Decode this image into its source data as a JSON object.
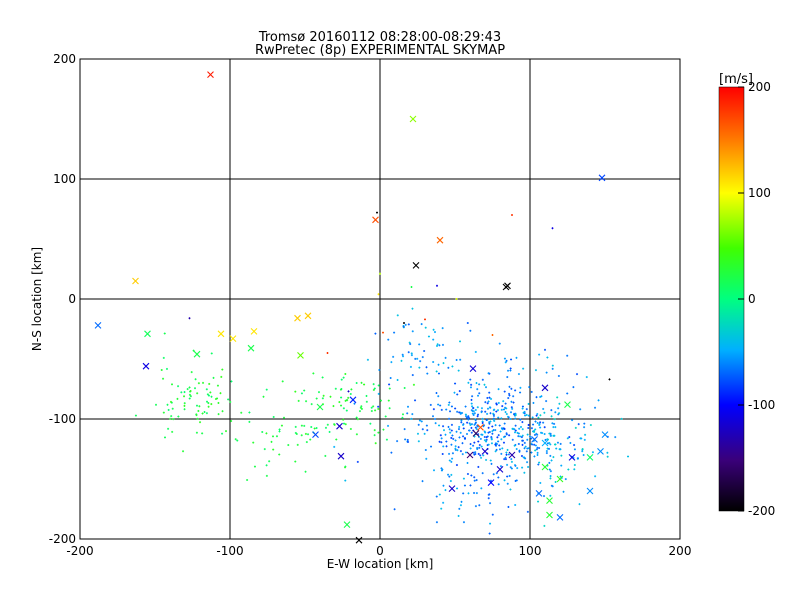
{
  "chart_data": {
    "type": "scatter",
    "title": "Tromsø 20160112 08:28:00-08:29:43",
    "subtitle": "RwPretec (8p) EXPERIMENTAL SKYMAP",
    "xlabel": "E-W location [km]",
    "ylabel": "N-S location [km]",
    "xlim": [
      -200,
      200
    ],
    "ylim": [
      -200,
      200
    ],
    "xticks": [
      "-200",
      "-100",
      "0",
      "100",
      "200"
    ],
    "yticks": [
      "-200",
      "-100",
      "0",
      "100",
      "200"
    ],
    "grid": true,
    "colorbar": {
      "label": "[m/s]",
      "range": [
        -200,
        200
      ],
      "ticks": [
        "200",
        "100",
        "0",
        "-100",
        "-200"
      ]
    },
    "markers": [
      {
        "x": -113,
        "y": 187,
        "v": 190
      },
      {
        "x": 22,
        "y": 150,
        "v": 70
      },
      {
        "x": 148,
        "y": 101,
        "v": -80
      },
      {
        "x": -3,
        "y": 66,
        "v": 170
      },
      {
        "x": 40,
        "y": 49,
        "v": 160
      },
      {
        "x": 24,
        "y": 28,
        "v": -200
      },
      {
        "x": 85,
        "y": 11,
        "v": -200
      },
      {
        "x": 84,
        "y": 10,
        "v": -200
      },
      {
        "x": -163,
        "y": 15,
        "v": 120
      },
      {
        "x": -188,
        "y": -22,
        "v": -70
      },
      {
        "x": -155,
        "y": -29,
        "v": 15
      },
      {
        "x": -106,
        "y": -29,
        "v": 110
      },
      {
        "x": -84,
        "y": -27,
        "v": 110
      },
      {
        "x": -98,
        "y": -33,
        "v": 110
      },
      {
        "x": -55,
        "y": -16,
        "v": 120
      },
      {
        "x": -48,
        "y": -14,
        "v": 120
      },
      {
        "x": -53,
        "y": -47,
        "v": 60
      },
      {
        "x": -122,
        "y": -46,
        "v": 20
      },
      {
        "x": -86,
        "y": -41,
        "v": 20
      },
      {
        "x": -156,
        "y": -56,
        "v": -110
      },
      {
        "x": 62,
        "y": -58,
        "v": -115
      },
      {
        "x": 125,
        "y": -88,
        "v": 20
      },
      {
        "x": -40,
        "y": -90,
        "v": 20
      },
      {
        "x": -18,
        "y": -84,
        "v": -90
      },
      {
        "x": -27,
        "y": -106,
        "v": -120
      },
      {
        "x": -26,
        "y": -131,
        "v": -120
      },
      {
        "x": -43,
        "y": -113,
        "v": -80
      },
      {
        "x": 64,
        "y": -112,
        "v": -160
      },
      {
        "x": 70,
        "y": -127,
        "v": -120
      },
      {
        "x": 80,
        "y": -142,
        "v": -120
      },
      {
        "x": 74,
        "y": -153,
        "v": -100
      },
      {
        "x": 48,
        "y": -158,
        "v": -120
      },
      {
        "x": 67,
        "y": -107,
        "v": 170
      },
      {
        "x": 103,
        "y": -117,
        "v": -70
      },
      {
        "x": 110,
        "y": -140,
        "v": 30
      },
      {
        "x": 120,
        "y": -150,
        "v": 40
      },
      {
        "x": 113,
        "y": -168,
        "v": 30
      },
      {
        "x": 113,
        "y": -180,
        "v": 30
      },
      {
        "x": 128,
        "y": -132,
        "v": -110
      },
      {
        "x": 140,
        "y": -132,
        "v": 10
      },
      {
        "x": 150,
        "y": -113,
        "v": -60
      },
      {
        "x": 147,
        "y": -127,
        "v": -60
      },
      {
        "x": 140,
        "y": -160,
        "v": -60
      },
      {
        "x": 120,
        "y": -182,
        "v": -70
      },
      {
        "x": 106,
        "y": -162,
        "v": -70
      },
      {
        "x": 110,
        "y": -120,
        "v": -50
      },
      {
        "x": 88,
        "y": -130,
        "v": -130
      },
      {
        "x": 60,
        "y": -130,
        "v": -150
      },
      {
        "x": 110,
        "y": -74,
        "v": -120
      },
      {
        "x": -22,
        "y": -188,
        "v": 20
      },
      {
        "x": -14,
        "y": -201,
        "v": -200
      }
    ],
    "dots": [
      {
        "x": -2,
        "y": 72,
        "v": -200
      },
      {
        "x": 88,
        "y": 70,
        "v": 180
      },
      {
        "x": 115,
        "y": 59,
        "v": -110
      },
      {
        "x": 38,
        "y": 11,
        "v": -110
      },
      {
        "x": 21,
        "y": 10,
        "v": 20
      },
      {
        "x": 0,
        "y": 21,
        "v": 80
      },
      {
        "x": -1,
        "y": 4,
        "v": 110
      },
      {
        "x": 51,
        "y": 0,
        "v": 90
      },
      {
        "x": -127,
        "y": -16,
        "v": -130
      },
      {
        "x": 30,
        "y": -17,
        "v": 180
      },
      {
        "x": 16,
        "y": -20,
        "v": -200
      },
      {
        "x": -35,
        "y": -45,
        "v": 180
      },
      {
        "x": 153,
        "y": -67,
        "v": -200
      },
      {
        "x": 2,
        "y": -28,
        "v": 170
      },
      {
        "x": 75,
        "y": -30,
        "v": 160
      },
      {
        "x": -21,
        "y": -77,
        "v": -120
      }
    ],
    "clusters": [
      {
        "cx": 70,
        "cy": -108,
        "sx": 25,
        "sy": 18,
        "n": 430,
        "vmin": -85,
        "vmax": -40
      },
      {
        "cx": 110,
        "cy": -125,
        "sx": 20,
        "sy": 22,
        "n": 120,
        "vmin": -70,
        "vmax": -25
      },
      {
        "cx": 28,
        "cy": -45,
        "sx": 20,
        "sy": 18,
        "n": 70,
        "vmin": -75,
        "vmax": -35
      },
      {
        "cx": -20,
        "cy": -88,
        "sx": 20,
        "sy": 16,
        "n": 75,
        "vmin": 5,
        "vmax": 40
      },
      {
        "cx": -60,
        "cy": -112,
        "sx": 26,
        "sy": 16,
        "n": 55,
        "vmin": 5,
        "vmax": 35
      },
      {
        "cx": -125,
        "cy": -85,
        "sx": 12,
        "sy": 16,
        "n": 80,
        "vmin": 5,
        "vmax": 40
      },
      {
        "cx": 60,
        "cy": -165,
        "sx": 25,
        "sy": 15,
        "n": 45,
        "vmin": -75,
        "vmax": -40
      },
      {
        "cx": 95,
        "cy": -60,
        "sx": 25,
        "sy": 12,
        "n": 30,
        "vmin": -80,
        "vmax": -40
      }
    ]
  }
}
